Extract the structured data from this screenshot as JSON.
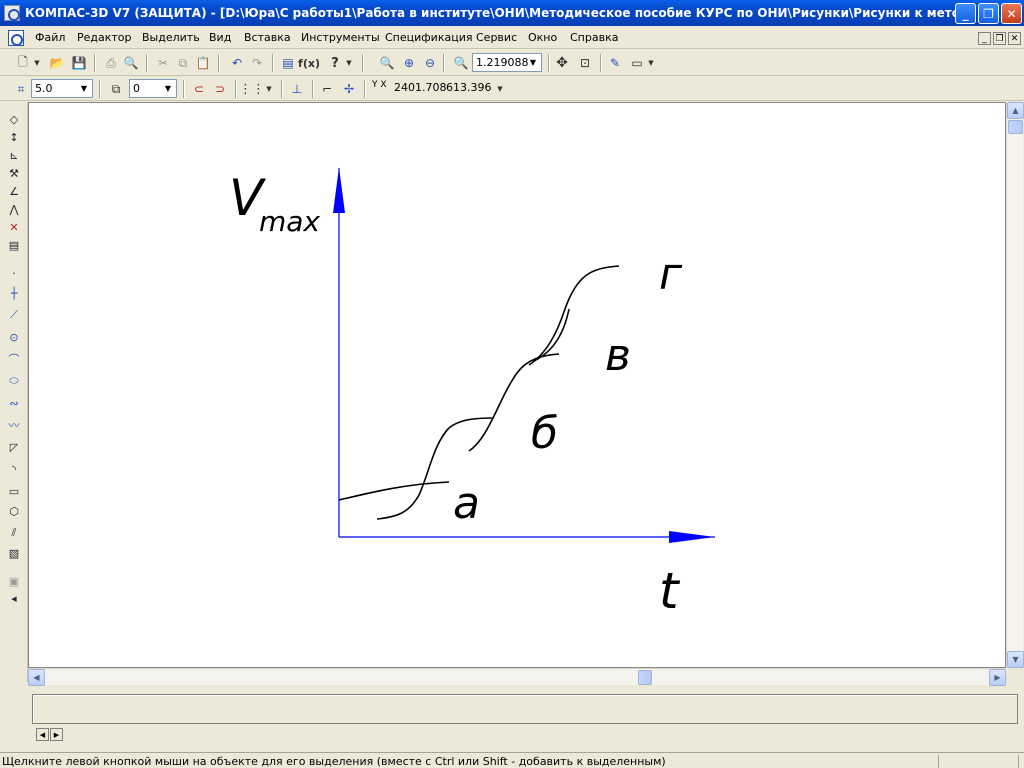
{
  "window": {
    "title": "КОМПАС-3D V7 (ЗАЩИТА) - [D:\\Юра\\С работы1\\Работа в институте\\ОНИ\\Методическое пособие КУРС по ОНИ\\Рисунки\\Рисунки к методичке  в К..."
  },
  "menu": {
    "items": [
      "Файл",
      "Редактор",
      "Выделить",
      "Вид",
      "Вставка",
      "Инструменты",
      "Спецификация",
      "Сервис",
      "Окно",
      "Справка"
    ]
  },
  "toolbar1": {
    "zoom_value": "1.219088"
  },
  "toolbar2": {
    "step_value": "5.0",
    "layer_value": "0",
    "coord_x": "2401.708",
    "coord_y": "613.396",
    "coord_label": "Y X"
  },
  "drawing": {
    "y_axis_label": "V",
    "y_axis_subscript": "max",
    "x_axis_label": "t",
    "curve_labels": [
      "а",
      "б",
      "в",
      "г"
    ],
    "axis_color": "#0000ff",
    "curve_color": "#000000"
  },
  "status": {
    "text": "Щелкните левой кнопкой мыши на объекте для его выделения (вместе с Ctrl или Shift - добавить к выделенным)"
  }
}
